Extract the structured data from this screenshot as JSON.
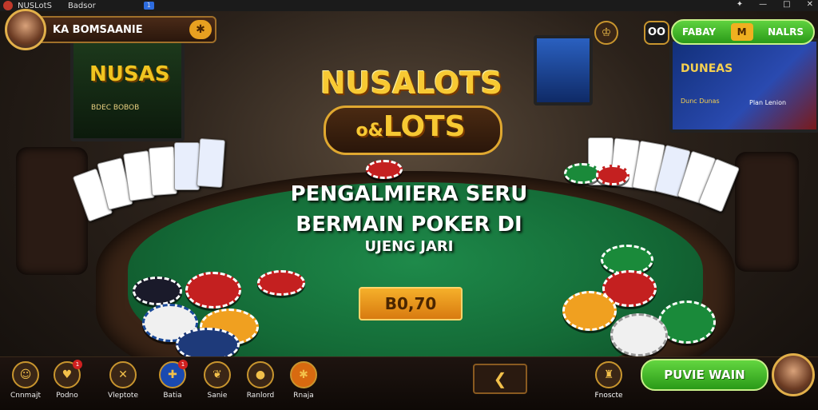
{
  "window": {
    "title": "NUSLotS",
    "menu": "Badsor",
    "tab_badge": "1"
  },
  "user": {
    "name": "KA BOMSAANIE",
    "action_icon": "star-icon"
  },
  "top_right": {
    "oo_label": "OO",
    "left_label": "FABAY",
    "right_label": "NALRS",
    "mid_label": "M"
  },
  "brand": {
    "line1": "NUSALOTS",
    "line2": "LOTS",
    "prefix": "o&"
  },
  "tv_left": {
    "logo": "NUSAS",
    "sub": "BDEC BOBOB"
  },
  "tv_right": {
    "title": "DUNEAS",
    "sub1": "Dunc Dunas",
    "sub2": "Plan Lenion"
  },
  "headline": {
    "line1": "PENGALMIERA SERU",
    "line2": "BERMAIN POKER DI",
    "line3": "UJENG JARI"
  },
  "amount": "B0,70",
  "nav": [
    {
      "label": "Cnnmajt",
      "icon": "avatar-icon"
    },
    {
      "label": "Podno",
      "icon": "heart-icon",
      "badge": "1"
    },
    {
      "label": "Vleptote",
      "icon": "cross-icon"
    },
    {
      "label": "Batia",
      "icon": "ticket-icon",
      "badge": "1"
    },
    {
      "label": "Sanie",
      "icon": "leaf-icon"
    },
    {
      "label": "Ranlord",
      "icon": "orange-icon"
    },
    {
      "label": "Rnaja",
      "icon": "star-icon"
    }
  ],
  "promo": {
    "label": "Fnoscte"
  },
  "play_button": "PUVIE WAIN"
}
